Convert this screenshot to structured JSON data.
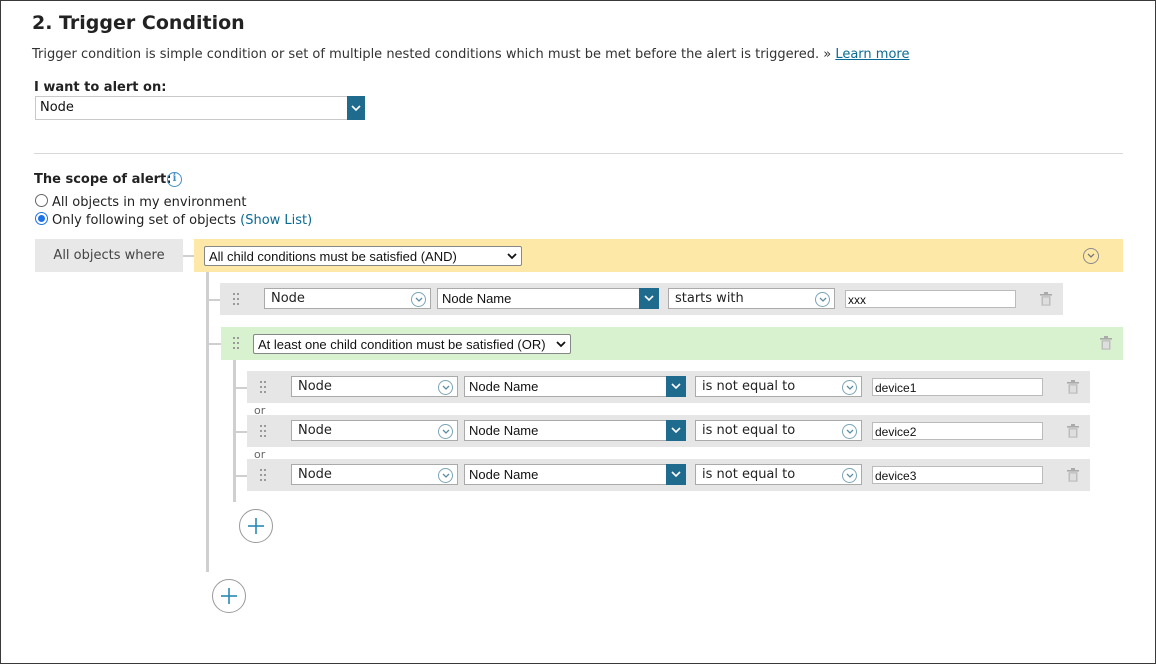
{
  "section": {
    "title": "2. Trigger Condition",
    "description": "Trigger condition is simple condition or set of multiple nested conditions which must be met before the alert is triggered. »",
    "learn_more": "Learn more"
  },
  "alert_on": {
    "label": "I want to alert on:",
    "value": "Node"
  },
  "scope": {
    "label": "The scope of alert:",
    "options": [
      {
        "label": "All objects in my environment",
        "selected": false
      },
      {
        "label": "Only following set of objects",
        "selected": true
      }
    ],
    "show_list": "(Show List)"
  },
  "builder": {
    "all_objects_where": "All objects where",
    "root_group": {
      "operator": "All child conditions must be satisfied (AND)",
      "color": "#fde8a7"
    },
    "condition_1": {
      "object": "Node",
      "field": "Node Name",
      "comparator": "starts with",
      "value": "xxx"
    },
    "or_group": {
      "operator": "At least one child condition must be satisfied (OR)",
      "color": "#d8f2cf",
      "separator": "or",
      "conditions": [
        {
          "object": "Node",
          "field": "Node Name",
          "comparator": "is not equal to",
          "value": "device1"
        },
        {
          "object": "Node",
          "field": "Node Name",
          "comparator": "is not equal to",
          "value": "device2"
        },
        {
          "object": "Node",
          "field": "Node Name",
          "comparator": "is not equal to",
          "value": "device3"
        }
      ]
    }
  },
  "colors": {
    "accent": "#1f6b8e",
    "link": "#0a6a94",
    "radio": "#1a73e8"
  }
}
